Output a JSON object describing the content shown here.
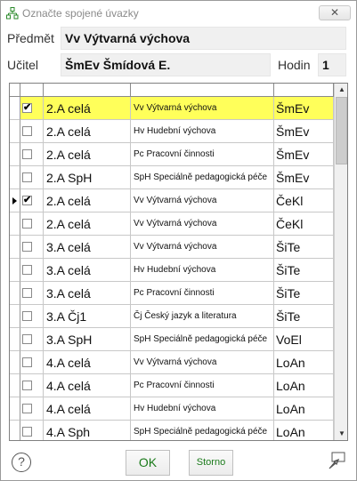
{
  "window": {
    "title": "Označte spojené úvazky",
    "close_label": "✕"
  },
  "header": {
    "predmet_label": "Předmět",
    "predmet_value": "Vv Výtvarná výchova",
    "ucitel_label": "Učitel",
    "ucitel_value": "ŠmEv Šmídová E.",
    "hodin_label": "Hodin",
    "hodin_value": "1"
  },
  "grid": {
    "rows": [
      {
        "checked": true,
        "current": false,
        "selected": true,
        "class": "2.A celá",
        "subject": "Vv Výtvarná výchova",
        "teacher": "ŠmEv"
      },
      {
        "checked": false,
        "current": false,
        "selected": false,
        "class": "2.A celá",
        "subject": "Hv Hudební výchova",
        "teacher": "ŠmEv"
      },
      {
        "checked": false,
        "current": false,
        "selected": false,
        "class": "2.A celá",
        "subject": "Pc Pracovní činnosti",
        "teacher": "ŠmEv"
      },
      {
        "checked": false,
        "current": false,
        "selected": false,
        "class": "2.A SpH",
        "subject": "SpH Speciálně pedagogická péče",
        "teacher": "ŠmEv"
      },
      {
        "checked": true,
        "current": true,
        "selected": false,
        "class": "2.A celá",
        "subject": "Vv Výtvarná výchova",
        "teacher": "ČeKl"
      },
      {
        "checked": false,
        "current": false,
        "selected": false,
        "class": "2.A celá",
        "subject": "Vv Výtvarná výchova",
        "teacher": "ČeKl"
      },
      {
        "checked": false,
        "current": false,
        "selected": false,
        "class": "3.A celá",
        "subject": "Vv Výtvarná výchova",
        "teacher": "ŠiTe"
      },
      {
        "checked": false,
        "current": false,
        "selected": false,
        "class": "3.A celá",
        "subject": "Hv Hudební výchova",
        "teacher": "ŠiTe"
      },
      {
        "checked": false,
        "current": false,
        "selected": false,
        "class": "3.A celá",
        "subject": "Pc Pracovní činnosti",
        "teacher": "ŠiTe"
      },
      {
        "checked": false,
        "current": false,
        "selected": false,
        "class": "3.A Čj1",
        "subject": "Čj Český jazyk a literatura",
        "teacher": "ŠiTe"
      },
      {
        "checked": false,
        "current": false,
        "selected": false,
        "class": "3.A SpH",
        "subject": "SpH Speciálně pedagogická péče",
        "teacher": "VoEl"
      },
      {
        "checked": false,
        "current": false,
        "selected": false,
        "class": "4.A celá",
        "subject": "Vv Výtvarná výchova",
        "teacher": "LoAn"
      },
      {
        "checked": false,
        "current": false,
        "selected": false,
        "class": "4.A celá",
        "subject": "Pc Pracovní činnosti",
        "teacher": "LoAn"
      },
      {
        "checked": false,
        "current": false,
        "selected": false,
        "class": "4.A celá",
        "subject": "Hv Hudební výchova",
        "teacher": "LoAn"
      },
      {
        "checked": false,
        "current": false,
        "selected": false,
        "class": "4.A Sph",
        "subject": "SpH Speciálně pedagogická péče",
        "teacher": "LoAn"
      }
    ]
  },
  "buttons": {
    "ok_label": "OK",
    "storno_label": "Storno",
    "help_label": "?"
  },
  "colors": {
    "selected_row": "#ffff5a",
    "button_text": "#1a7a1a"
  }
}
